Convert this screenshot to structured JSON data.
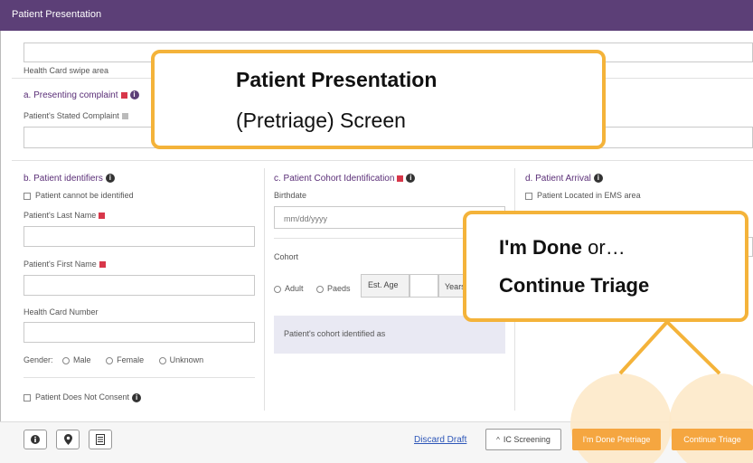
{
  "window": {
    "title": "Patient Presentation"
  },
  "health_card": {
    "label": "Health Card swipe area",
    "value": ""
  },
  "presenting_complaint": {
    "title": "a. Presenting complaint",
    "stated_label": "Patient's Stated Complaint",
    "value": ""
  },
  "identifiers": {
    "title": "b. Patient identifiers",
    "cannot_identify": "Patient cannot be identified",
    "last_name_label": "Patient's Last Name",
    "first_name_label": "Patient's First Name",
    "health_card_label": "Health Card Number",
    "gender_label": "Gender:",
    "gender_options": [
      "Male",
      "Female",
      "Unknown"
    ],
    "no_consent": "Patient Does Not Consent"
  },
  "cohort": {
    "title": "c. Patient Cohort Identification",
    "birthdate_label": "Birthdate",
    "birthdate_placeholder": "mm/dd/yyyy",
    "cohort_label": "Cohort",
    "options": [
      "Adult",
      "Paeds"
    ],
    "est_age": "Est. Age",
    "years": "Years",
    "identified_as": "Patient's cohort identified as"
  },
  "arrival": {
    "title": "d. Patient Arrival",
    "ems_area": "Patient Located in EMS area"
  },
  "callouts": {
    "presentation_bold": "Patient Presentation",
    "presentation_rest": "(Pretriage) Screen",
    "done_bold": "I'm Done",
    "done_rest": " or…",
    "continue": "Continue Triage"
  },
  "footer": {
    "discard": "Discard Draft",
    "ic_screening": "IC Screening",
    "done_pretriage": "I'm Done Pretriage",
    "continue_triage": "Continue Triage",
    "icons": [
      "info-icon",
      "location-pin-icon",
      "document-icon"
    ]
  },
  "colors": {
    "header": "#5c3f77",
    "accent": "#f4b33a",
    "required": "#d8374a",
    "button": "#f5a640"
  }
}
